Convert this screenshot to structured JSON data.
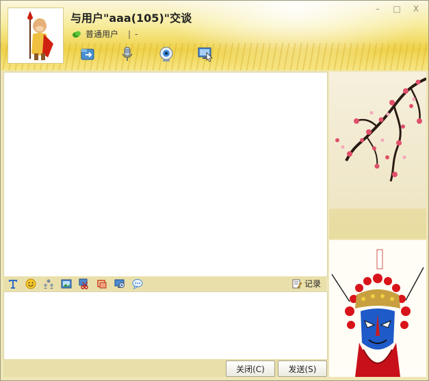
{
  "window": {
    "title": "与用户\"aaa(105)\"交谈",
    "controls": {
      "minimize_glyph": "–",
      "maximize_glyph": "□",
      "close_glyph": "X"
    }
  },
  "user": {
    "status_text": "普通用户",
    "separator": "|",
    "extra": "-"
  },
  "header_tools": [
    {
      "icon": "file-transfer-icon"
    },
    {
      "icon": "microphone-icon"
    },
    {
      "icon": "webcam-icon"
    },
    {
      "icon": "remote-desktop-icon"
    }
  ],
  "chat_toolbar": {
    "icons": [
      "font-icon",
      "emoticon-icon",
      "contacts-icon",
      "image-icon",
      "screen-capture-icon",
      "shake-icon",
      "screen-share-icon",
      "chat-bubble-icon"
    ],
    "record_label": "记录"
  },
  "buttons": {
    "close_label": "关闭(C)",
    "send_label": "发送(S)"
  },
  "colors": {
    "header_gold": "#efd24a",
    "panel": "#e9dfaa",
    "border": "#d8d0a4"
  }
}
